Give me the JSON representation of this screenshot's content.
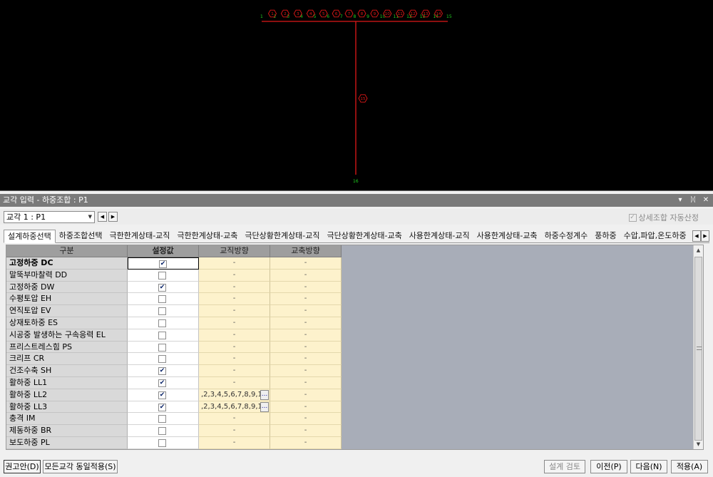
{
  "viewport": {
    "top_labels": [
      "1",
      "2",
      "3",
      "4",
      "5",
      "6",
      "7",
      "8",
      "9",
      "10",
      "11",
      "12",
      "13",
      "14",
      "15"
    ],
    "top_markers": [
      "1",
      "2",
      "3",
      "4",
      "5",
      "6",
      "7",
      "8",
      "9",
      "10",
      "11",
      "12",
      "13",
      "14"
    ],
    "center_marker": "15",
    "bottom_label": "16",
    "colors": {
      "line": "#e01818",
      "label": "#20d020",
      "background": "#000000"
    }
  },
  "panel": {
    "title": "교각 입력 - 하중조합 : P1",
    "controls": [
      "▾",
      "ᛞ",
      "✕"
    ]
  },
  "pier_select": {
    "value": "교각 1 : P1"
  },
  "auto_check": {
    "label": "상세조합 자동산정",
    "checked": true
  },
  "tabs": [
    "설계하중선택",
    "하중조합선택",
    "극한한계상태-교직",
    "극한한계상태-교축",
    "극단상황한계상태-교직",
    "극단상황한계상태-교축",
    "사용한계상태-교직",
    "사용한계상태-교축",
    "하중수정계수",
    "풍하중",
    "수압,파압,온도하중"
  ],
  "table": {
    "headers": [
      "구분",
      "설정값",
      "교직방향",
      "교축방향"
    ],
    "rows": [
      {
        "name": "고정하중 DC",
        "checked": true,
        "bold": true,
        "dir1": "-",
        "dir2": "-"
      },
      {
        "name": "말뚝부마찰력 DD",
        "checked": false,
        "dir1": "-",
        "dir2": "-"
      },
      {
        "name": "고정하중 DW",
        "checked": true,
        "dir1": "-",
        "dir2": "-"
      },
      {
        "name": "수평토압 EH",
        "checked": false,
        "dir1": "-",
        "dir2": "-"
      },
      {
        "name": "연직토압 EV",
        "checked": false,
        "dir1": "-",
        "dir2": "-"
      },
      {
        "name": "상재토하중 ES",
        "checked": false,
        "dir1": "-",
        "dir2": "-"
      },
      {
        "name": "시공중 발생하는 구속응력 EL",
        "checked": false,
        "dir1": "-",
        "dir2": "-"
      },
      {
        "name": "프리스트레스힘 PS",
        "checked": false,
        "dir1": "-",
        "dir2": "-"
      },
      {
        "name": "크리프 CR",
        "checked": false,
        "dir1": "-",
        "dir2": "-"
      },
      {
        "name": "건조수축 SH",
        "checked": true,
        "dir1": "-",
        "dir2": "-"
      },
      {
        "name": "활하중 LL1",
        "checked": true,
        "dir1": "-",
        "dir2": "-"
      },
      {
        "name": "활하중 LL2",
        "checked": true,
        "dir1": ",2,3,4,5,6,7,8,9,1(",
        "dir1_button": "...",
        "dir2": "-"
      },
      {
        "name": "활하중 LL3",
        "checked": true,
        "dir1": ",2,3,4,5,6,7,8,9,1(",
        "dir1_button": "...",
        "dir2": "-"
      },
      {
        "name": "충격 IM",
        "checked": false,
        "dir1": "-",
        "dir2": "-"
      },
      {
        "name": "제동하중 BR",
        "checked": false,
        "dir1": "-",
        "dir2": "-"
      },
      {
        "name": "보도하중 PL",
        "checked": false,
        "dir1": "-",
        "dir2": "-"
      }
    ]
  },
  "buttons": {
    "recommend": "권고안(D)",
    "apply_all": "모든교각 동일적용(S)",
    "design_check": "설계 검토",
    "prev": "이전(P)",
    "next": "다음(N)",
    "apply": "적용(A)"
  }
}
